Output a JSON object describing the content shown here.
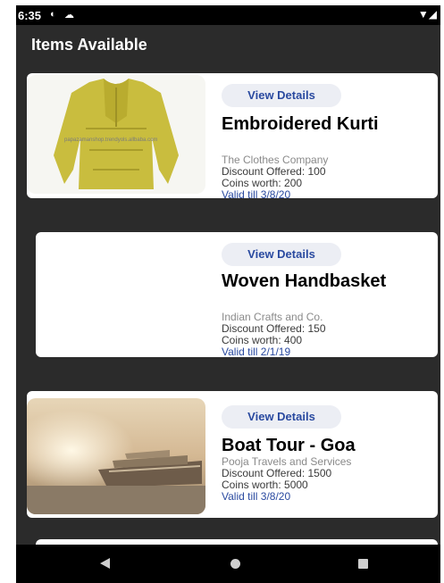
{
  "status": {
    "time": "6:35"
  },
  "header": {
    "title": "Items Available"
  },
  "items": [
    {
      "view_label": "View Details",
      "name": "Embroidered Kurti",
      "company": "The Clothes Company",
      "discount": "Discount Offered: 100",
      "coins": "Coins worth: 200",
      "valid": "Valid till 3/8/20",
      "image": "kurti-image",
      "image_watermark": "papazamanshop.trendyols.allbaba.com"
    },
    {
      "view_label": "View Details",
      "name": "Woven Handbasket",
      "company": "Indian Crafts and Co.",
      "discount": "Discount Offered: 150",
      "coins": "Coins worth: 400",
      "valid": "Valid till 2/1/19"
    },
    {
      "view_label": "View Details",
      "name": "Boat Tour - Goa",
      "company": "Pooja Travels and Services",
      "discount": "Discount Offered: 1500",
      "coins": "Coins worth: 5000",
      "valid": "Valid till 3/8/20",
      "image": "boat-image"
    }
  ],
  "nav": {
    "back_icon": "back-icon",
    "home_icon": "home-icon",
    "recents_icon": "recents-icon"
  },
  "colors": {
    "background": "#2b2b2b",
    "card": "#ffffff",
    "accent": "#2a4aa0",
    "button_bg": "#eceef4"
  }
}
